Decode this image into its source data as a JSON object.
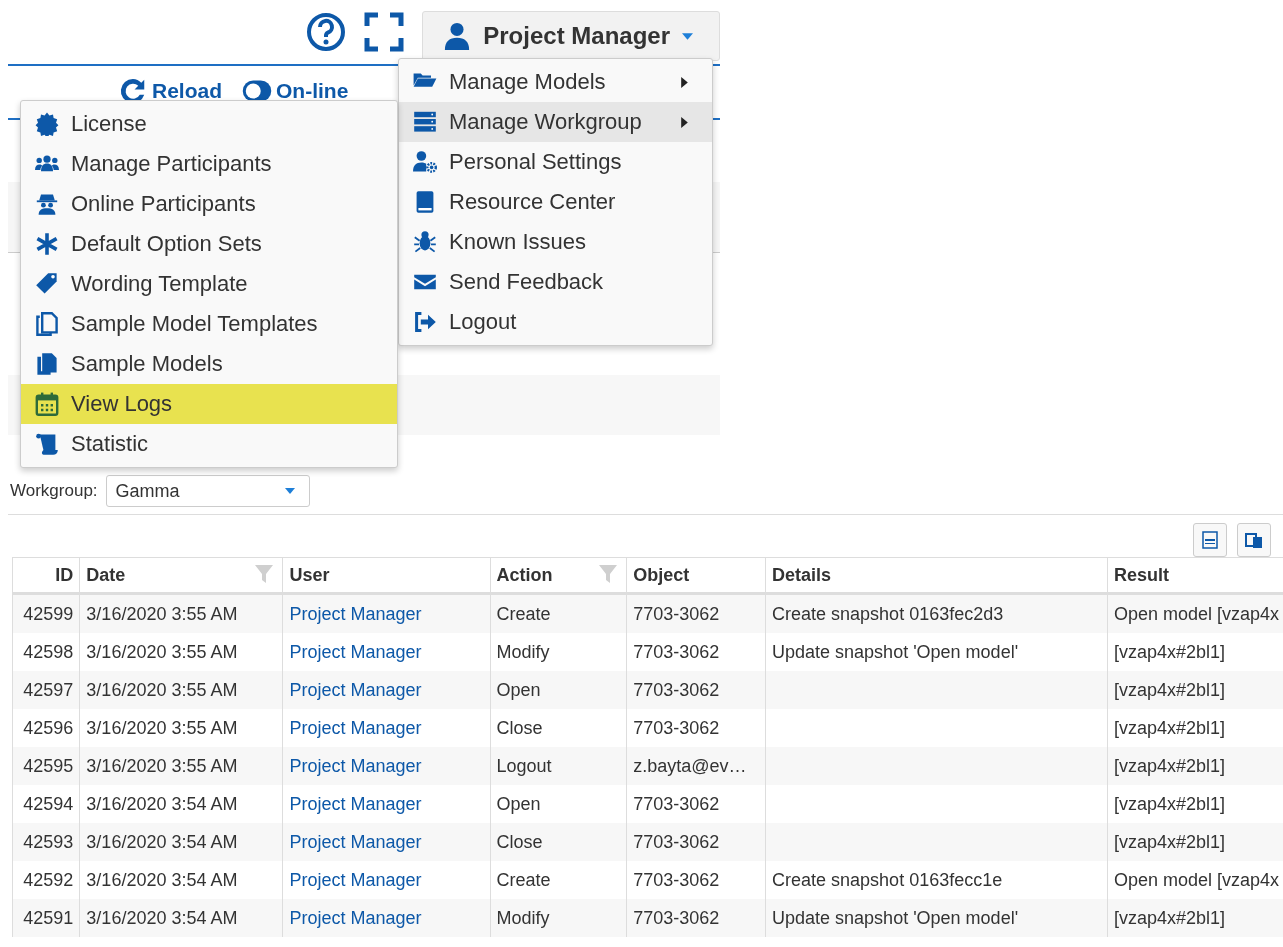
{
  "header": {
    "user_button": "Project Manager"
  },
  "toolbar": [
    {
      "label": "Reload"
    },
    {
      "label": "On-line"
    }
  ],
  "user_menu": [
    {
      "label": "Manage Models",
      "has_submenu": true,
      "selected": false
    },
    {
      "label": "Manage Workgroup",
      "has_submenu": true,
      "selected": true
    },
    {
      "label": "Personal Settings",
      "has_submenu": false,
      "selected": false
    },
    {
      "label": "Resource Center",
      "has_submenu": false,
      "selected": false
    },
    {
      "label": "Known Issues",
      "has_submenu": false,
      "selected": false
    },
    {
      "label": "Send Feedback",
      "has_submenu": false,
      "selected": false
    },
    {
      "label": "Logout",
      "has_submenu": false,
      "selected": false
    }
  ],
  "workgroup_menu": [
    {
      "label": "License",
      "selected": false
    },
    {
      "label": "Manage Participants",
      "selected": false
    },
    {
      "label": "Online Participants",
      "selected": false
    },
    {
      "label": "Default Option Sets",
      "selected": false
    },
    {
      "label": "Wording Template",
      "selected": false
    },
    {
      "label": "Sample Model Templates",
      "selected": false
    },
    {
      "label": "Sample Models",
      "selected": false
    },
    {
      "label": "View Logs",
      "selected": true
    },
    {
      "label": "Statistic",
      "selected": false
    }
  ],
  "workgroup_filter": {
    "label": "Workgroup:",
    "value": "Gamma"
  },
  "table": {
    "columns": [
      {
        "label": "ID",
        "filterable": false
      },
      {
        "label": "Date",
        "filterable": true
      },
      {
        "label": "User",
        "filterable": false
      },
      {
        "label": "Action",
        "filterable": true
      },
      {
        "label": "Object",
        "filterable": false
      },
      {
        "label": "Details",
        "filterable": false
      },
      {
        "label": "Result",
        "filterable": false
      }
    ],
    "rows": [
      [
        "42599",
        "3/16/2020 3:55 AM",
        "Project Manager",
        "Create",
        "7703-3062",
        "Create snapshot 0163fec2d3",
        "Open model [vzap4x"
      ],
      [
        "42598",
        "3/16/2020 3:55 AM",
        "Project Manager",
        "Modify",
        "7703-3062",
        "Update snapshot 'Open model'",
        "[vzap4x#2bl1]"
      ],
      [
        "42597",
        "3/16/2020 3:55 AM",
        "Project Manager",
        "Open",
        "7703-3062",
        "",
        "[vzap4x#2bl1]"
      ],
      [
        "42596",
        "3/16/2020 3:55 AM",
        "Project Manager",
        "Close",
        "7703-3062",
        "",
        "[vzap4x#2bl1]"
      ],
      [
        "42595",
        "3/16/2020 3:55 AM",
        "Project Manager",
        "Logout",
        "z.bayta@ev…",
        "",
        "[vzap4x#2bl1]"
      ],
      [
        "42594",
        "3/16/2020 3:54 AM",
        "Project Manager",
        "Open",
        "7703-3062",
        "",
        "[vzap4x#2bl1]"
      ],
      [
        "42593",
        "3/16/2020 3:54 AM",
        "Project Manager",
        "Close",
        "7703-3062",
        "",
        "[vzap4x#2bl1]"
      ],
      [
        "42592",
        "3/16/2020 3:54 AM",
        "Project Manager",
        "Create",
        "7703-3062",
        "Create snapshot 0163fecc1e",
        "Open model [vzap4x"
      ],
      [
        "42591",
        "3/16/2020 3:54 AM",
        "Project Manager",
        "Modify",
        "7703-3062",
        "Update snapshot 'Open model'",
        "[vzap4x#2bl1]"
      ]
    ]
  }
}
